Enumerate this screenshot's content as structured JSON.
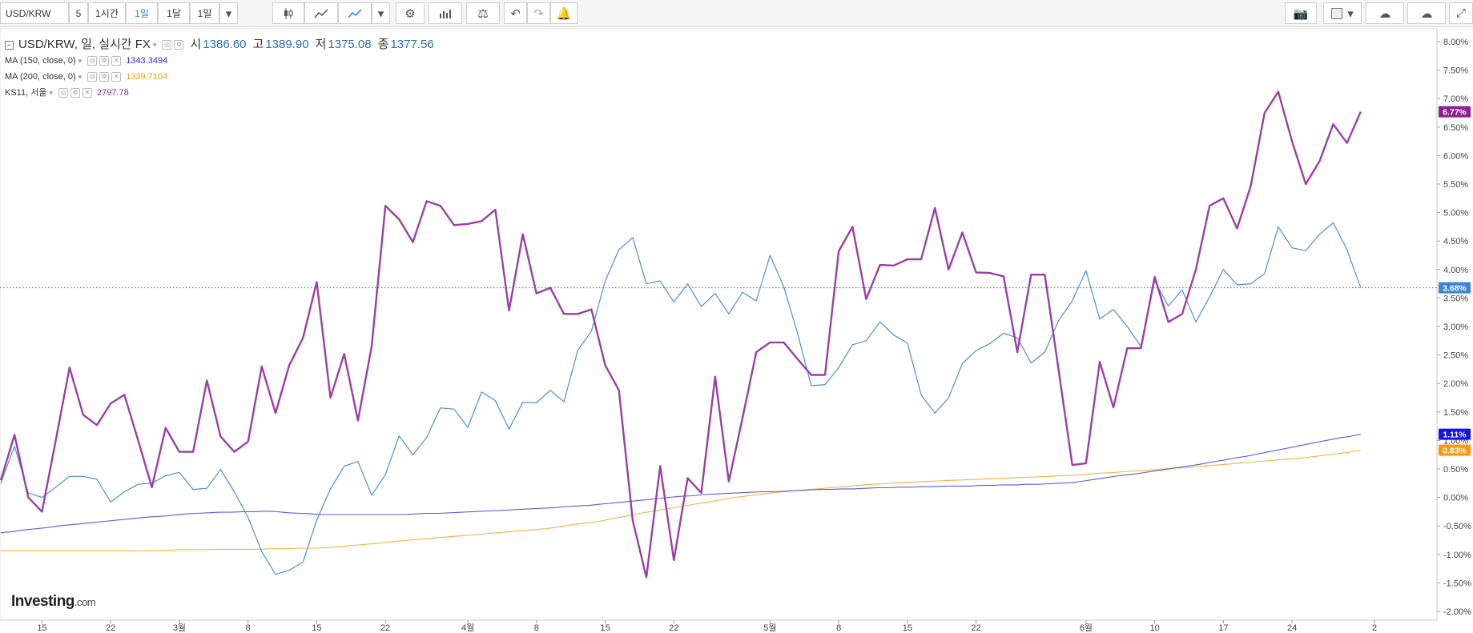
{
  "toolbar": {
    "symbol": "USD/KRW",
    "interval_value": "5",
    "buttons": [
      "1시간",
      "1일",
      "1달",
      "1일"
    ],
    "active_index": 1
  },
  "legend": {
    "main": {
      "title": "USD/KRW, 일, 실시간 FX",
      "open_label": "시",
      "open": "1386.60",
      "high_label": "고",
      "high": "1389.90",
      "low_label": "저",
      "low": "1375.08",
      "close_label": "종",
      "close": "1377.56"
    },
    "ma150": {
      "label": "MA (150, close, 0)",
      "value": "1343.3494",
      "color": "#3333dd"
    },
    "ma200": {
      "label": "MA (200, close, 0)",
      "value": "1339.7104",
      "color": "#f39c12"
    },
    "ks11": {
      "label": "KS11, 서울",
      "value": "2797.78",
      "color": "#8e2a8e"
    }
  },
  "logo": {
    "brand": "Investing",
    "suffix": ".com"
  },
  "colors": {
    "usdkrw": "#4a8fd6",
    "ks11": "#9b3fa6",
    "ma150": "#5b5be0",
    "ma200": "#f5b041",
    "grid": "#e8e8e8"
  },
  "chart_data": {
    "type": "line",
    "yaxis_unit": "%",
    "ylim": [
      -2.0,
      8.0
    ],
    "y_ticks": [
      "-2.00%",
      "-1.50%",
      "-1.00%",
      "-0.50%",
      "0.00%",
      "0.50%",
      "1.00%",
      "1.50%",
      "2.00%",
      "2.50%",
      "3.00%",
      "3.50%",
      "4.00%",
      "4.50%",
      "5.00%",
      "5.50%",
      "6.00%",
      "6.50%",
      "7.00%",
      "7.50%",
      "8.00%"
    ],
    "x_ticks": [
      {
        "label": "15",
        "index": 3
      },
      {
        "label": "22",
        "index": 8
      },
      {
        "label": "3월",
        "index": 13
      },
      {
        "label": "8",
        "index": 18
      },
      {
        "label": "15",
        "index": 23
      },
      {
        "label": "22",
        "index": 28
      },
      {
        "label": "4월",
        "index": 34
      },
      {
        "label": "8",
        "index": 39
      },
      {
        "label": "15",
        "index": 44
      },
      {
        "label": "22",
        "index": 49
      },
      {
        "label": "5월",
        "index": 56
      },
      {
        "label": "8",
        "index": 61
      },
      {
        "label": "15",
        "index": 66
      },
      {
        "label": "22",
        "index": 71
      },
      {
        "label": "6월",
        "index": 79
      },
      {
        "label": "10",
        "index": 84
      },
      {
        "label": "17",
        "index": 89
      },
      {
        "label": "24",
        "index": 94
      },
      {
        "label": "2",
        "index": 100
      }
    ],
    "x_max_index": 106,
    "current_value_line": 3.68,
    "series": [
      {
        "name": "KS11",
        "badge": "6.77%",
        "values": [
          0.3,
          1.1,
          0.0,
          -0.25,
          1.0,
          2.28,
          1.45,
          1.27,
          1.65,
          1.8,
          1.0,
          0.18,
          1.22,
          0.8,
          0.8,
          2.05,
          1.07,
          0.8,
          0.98,
          2.3,
          1.48,
          2.32,
          2.8,
          3.78,
          1.75,
          2.52,
          1.35,
          2.65,
          5.12,
          4.88,
          4.48,
          5.2,
          5.12,
          4.78,
          4.8,
          4.85,
          5.05,
          3.28,
          4.62,
          3.58,
          3.68,
          3.22,
          3.22,
          3.3,
          2.32,
          1.88,
          -0.4,
          -1.4,
          0.55,
          -1.1,
          0.34,
          0.08,
          2.12,
          0.28,
          1.4,
          2.55,
          2.72,
          2.72,
          2.43,
          2.15,
          2.15,
          4.32,
          4.75,
          3.48,
          4.08,
          4.07,
          4.18,
          4.18,
          5.08,
          4.0,
          4.65,
          3.95,
          3.94,
          3.88,
          2.55,
          3.91,
          3.91,
          2.25,
          0.57,
          0.6,
          2.38,
          1.58,
          2.62,
          2.62,
          3.87,
          3.08,
          3.22,
          4.0,
          5.12,
          5.25,
          4.72,
          5.47,
          6.75,
          7.12,
          6.25,
          5.5,
          5.9,
          6.55,
          6.22,
          6.77
        ]
      },
      {
        "name": "USD/KRW",
        "badge": "3.68%",
        "values": [
          0.25,
          0.9,
          0.08,
          0.0,
          0.18,
          0.37,
          0.37,
          0.32,
          -0.08,
          0.1,
          0.23,
          0.25,
          0.38,
          0.44,
          0.14,
          0.16,
          0.49,
          0.1,
          -0.35,
          -0.95,
          -1.35,
          -1.28,
          -1.13,
          -0.4,
          0.15,
          0.55,
          0.63,
          0.04,
          0.4,
          1.08,
          0.75,
          1.05,
          1.57,
          1.55,
          1.23,
          1.85,
          1.7,
          1.2,
          1.67,
          1.66,
          1.88,
          1.68,
          2.58,
          2.92,
          3.8,
          4.35,
          4.56,
          3.75,
          3.8,
          3.43,
          3.75,
          3.35,
          3.58,
          3.22,
          3.6,
          3.45,
          4.25,
          3.7,
          2.88,
          1.96,
          1.98,
          2.28,
          2.68,
          2.75,
          3.08,
          2.85,
          2.71,
          1.8,
          1.48,
          1.75,
          2.35,
          2.58,
          2.7,
          2.88,
          2.8,
          2.36,
          2.55,
          3.1,
          3.45,
          3.98,
          3.13,
          3.3,
          3.0,
          2.65,
          3.8,
          3.36,
          3.64,
          3.08,
          3.52,
          4.0,
          3.73,
          3.75,
          3.93,
          4.75,
          4.38,
          4.33,
          4.62,
          4.82,
          4.35,
          3.68
        ]
      },
      {
        "name": "MA (150, close, 0)",
        "badge": "1.11%",
        "values": [
          -0.62,
          -0.6,
          -0.57,
          -0.55,
          -0.53,
          -0.5,
          -0.48,
          -0.46,
          -0.44,
          -0.42,
          -0.4,
          -0.38,
          -0.36,
          -0.34,
          -0.33,
          -0.31,
          -0.29,
          -0.28,
          -0.27,
          -0.26,
          -0.26,
          -0.25,
          -0.25,
          -0.24,
          -0.25,
          -0.27,
          -0.28,
          -0.29,
          -0.3,
          -0.3,
          -0.3,
          -0.3,
          -0.3,
          -0.3,
          -0.3,
          -0.3,
          -0.29,
          -0.28,
          -0.28,
          -0.27,
          -0.26,
          -0.25,
          -0.24,
          -0.23,
          -0.22,
          -0.21,
          -0.2,
          -0.19,
          -0.18,
          -0.16,
          -0.15,
          -0.14,
          -0.12,
          -0.1,
          -0.08,
          -0.06,
          -0.04,
          -0.02,
          0.0,
          0.02,
          0.03,
          0.05,
          0.06,
          0.07,
          0.08,
          0.09,
          0.1,
          0.1,
          0.11,
          0.12,
          0.13,
          0.14,
          0.14,
          0.15,
          0.15,
          0.16,
          0.17,
          0.17,
          0.18,
          0.18,
          0.19,
          0.19,
          0.2,
          0.2,
          0.2,
          0.21,
          0.21,
          0.22,
          0.22,
          0.23,
          0.23,
          0.24,
          0.25,
          0.26,
          0.29,
          0.32,
          0.35,
          0.38,
          0.4,
          0.43,
          0.46,
          0.49,
          0.52,
          0.55,
          0.58,
          0.62,
          0.65,
          0.69,
          0.72,
          0.76,
          0.8,
          0.84,
          0.88,
          0.92,
          0.96,
          1.0,
          1.04,
          1.07,
          1.11
        ]
      },
      {
        "name": "MA (200, close, 0)",
        "badge": "0.83%",
        "values": [
          -0.93,
          -0.93,
          -0.93,
          -0.93,
          -0.93,
          -0.93,
          -0.93,
          -0.93,
          -0.93,
          -0.93,
          -0.94,
          -0.93,
          -0.93,
          -0.92,
          -0.92,
          -0.92,
          -0.91,
          -0.91,
          -0.91,
          -0.91,
          -0.9,
          -0.9,
          -0.89,
          -0.89,
          -0.88,
          -0.86,
          -0.84,
          -0.82,
          -0.8,
          -0.77,
          -0.75,
          -0.73,
          -0.71,
          -0.69,
          -0.67,
          -0.65,
          -0.63,
          -0.61,
          -0.59,
          -0.57,
          -0.55,
          -0.52,
          -0.48,
          -0.45,
          -0.42,
          -0.37,
          -0.33,
          -0.28,
          -0.24,
          -0.2,
          -0.16,
          -0.12,
          -0.08,
          -0.04,
          0.0,
          0.03,
          0.06,
          0.09,
          0.11,
          0.13,
          0.15,
          0.17,
          0.19,
          0.21,
          0.23,
          0.24,
          0.26,
          0.27,
          0.28,
          0.29,
          0.3,
          0.31,
          0.32,
          0.33,
          0.34,
          0.35,
          0.36,
          0.37,
          0.38,
          0.39,
          0.41,
          0.43,
          0.44,
          0.46,
          0.47,
          0.49,
          0.51,
          0.52,
          0.54,
          0.56,
          0.58,
          0.6,
          0.62,
          0.64,
          0.66,
          0.68,
          0.7,
          0.73,
          0.76,
          0.79,
          0.83
        ]
      }
    ]
  }
}
